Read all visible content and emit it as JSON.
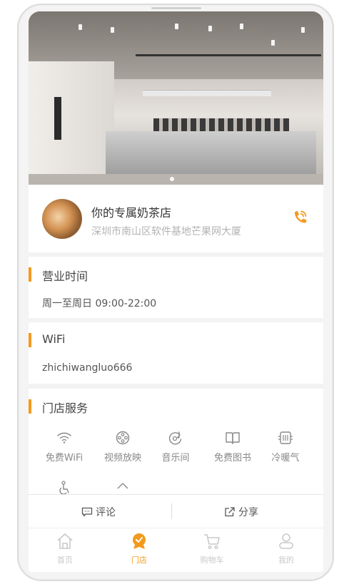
{
  "hero": {
    "alt": "store-interior-photo",
    "carousel_dots": 1
  },
  "shop": {
    "name": "你的专属奶茶店",
    "address": "深圳市南山区软件基地芒果网大厦",
    "call_icon": "phone-call-icon"
  },
  "hours": {
    "title": "营业时间",
    "value": "周一至周日  09:00-22:00"
  },
  "wifi": {
    "title": "WiFi",
    "value": "zhichiwangluo666"
  },
  "services": {
    "title": "门店服务",
    "items": [
      {
        "label": "免费WiFi",
        "icon": "wifi-icon"
      },
      {
        "label": "视频放映",
        "icon": "film-reel-icon"
      },
      {
        "label": "音乐间",
        "icon": "music-disc-icon"
      },
      {
        "label": "免费图书",
        "icon": "book-icon"
      },
      {
        "label": "冷暖气",
        "icon": "air-conditioner-icon"
      },
      {
        "label": "",
        "icon": "wheelchair-icon"
      },
      {
        "label": "",
        "icon": "parking-icon"
      }
    ]
  },
  "actions": {
    "comment": "评论",
    "share": "分享"
  },
  "tabbar": {
    "items": [
      {
        "label": "首页",
        "icon": "home-icon",
        "active": false
      },
      {
        "label": "门店",
        "icon": "store-badge-icon",
        "active": true
      },
      {
        "label": "购物车",
        "icon": "cart-icon",
        "active": false
      },
      {
        "label": "我的",
        "icon": "user-icon",
        "active": false
      }
    ]
  },
  "colors": {
    "accent": "#f39a1e",
    "inactive_tab": "#c9c9c9"
  }
}
